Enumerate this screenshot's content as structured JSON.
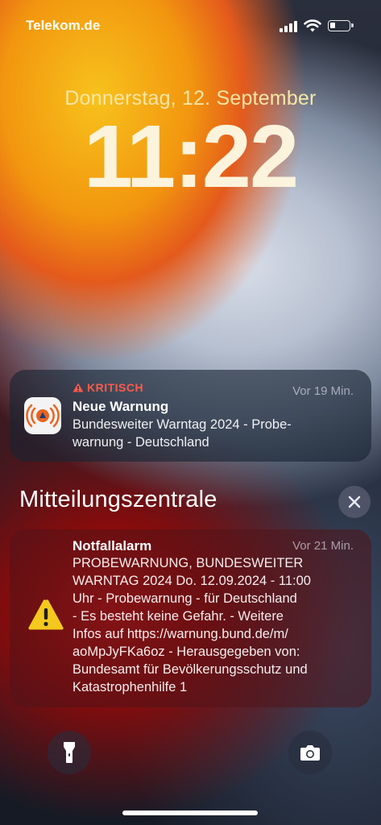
{
  "status_bar": {
    "carrier": "Telekom.de"
  },
  "lock": {
    "date": "Donnerstag, 12. September",
    "time": "11:22"
  },
  "notification_critical": {
    "badge": "KRITISCH",
    "time": "Vor 19 Min.",
    "title": "Neue Warnung",
    "body_line1": "Bundesweiter Warntag 2024 - Probe-",
    "body_line2": "warnung - Deutschland",
    "app_icon": "nina-warning-app-icon"
  },
  "notification_center": {
    "title": "Mitteilungszentrale",
    "close_icon": "close-icon"
  },
  "notification_alarm": {
    "title": "Notfallalarm",
    "time": "Vor 21 Min.",
    "lines": [
      "PROBEWARNUNG, BUNDESWEITER",
      "WARNTAG 2024 Do. 12.09.2024 - 11:00",
      "Uhr - Probewarnung - für Deutschland",
      "- Es besteht keine Gefahr. - Weitere",
      "Infos auf https://warnung.bund.de/m/",
      "aoMpJyFKa6oz - Herausgegeben von:",
      "Bundesamt für Bevölkerungsschutz und",
      "Katastrophenhilfe 1"
    ],
    "icon": "warning-triangle-icon"
  },
  "bottom": {
    "flashlight_icon": "flashlight-icon",
    "camera_icon": "camera-icon"
  },
  "colors": {
    "critical_red": "#ff5a4a",
    "date_color": "#f5e6a6",
    "warning_yellow": "#f4c81e"
  }
}
